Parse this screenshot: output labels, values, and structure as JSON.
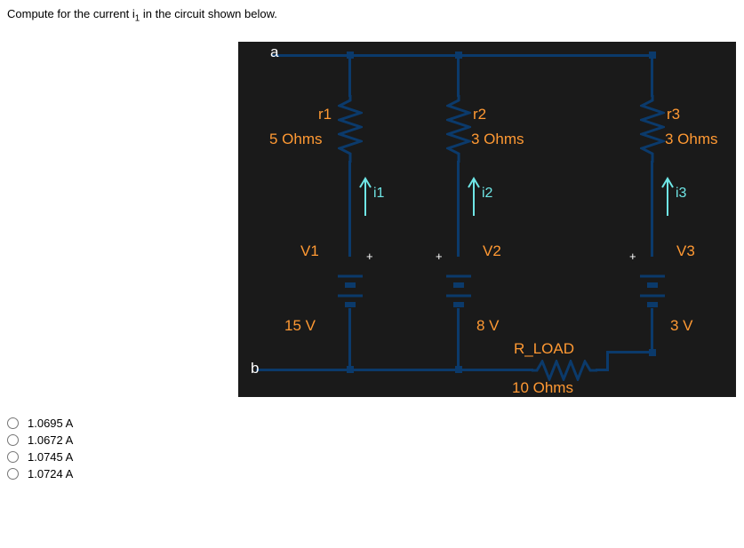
{
  "question_html": "Compute for the current i<sub>1</sub> in the circuit shown below.",
  "circuit": {
    "node_a": "a",
    "node_b": "b",
    "r1": {
      "name": "r1",
      "value": "5 Ohms"
    },
    "r2": {
      "name": "r2",
      "value": "3 Ohms"
    },
    "r3": {
      "name": "r3",
      "value": "3 Ohms"
    },
    "i1": "i1",
    "i2": "i2",
    "i3": "i3",
    "v1": {
      "name": "V1",
      "value": "15 V",
      "plus": "+"
    },
    "v2": {
      "name": "V2",
      "value": "8 V",
      "plus": "+"
    },
    "v3": {
      "name": "V3",
      "value": "3 V",
      "plus": "+"
    },
    "rload": {
      "name": "R_LOAD",
      "value": "10 Ohms"
    }
  },
  "options": [
    {
      "label": "1.0695 A"
    },
    {
      "label": "1.0672 A"
    },
    {
      "label": "1.0745 A"
    },
    {
      "label": "1.0724 A"
    }
  ]
}
